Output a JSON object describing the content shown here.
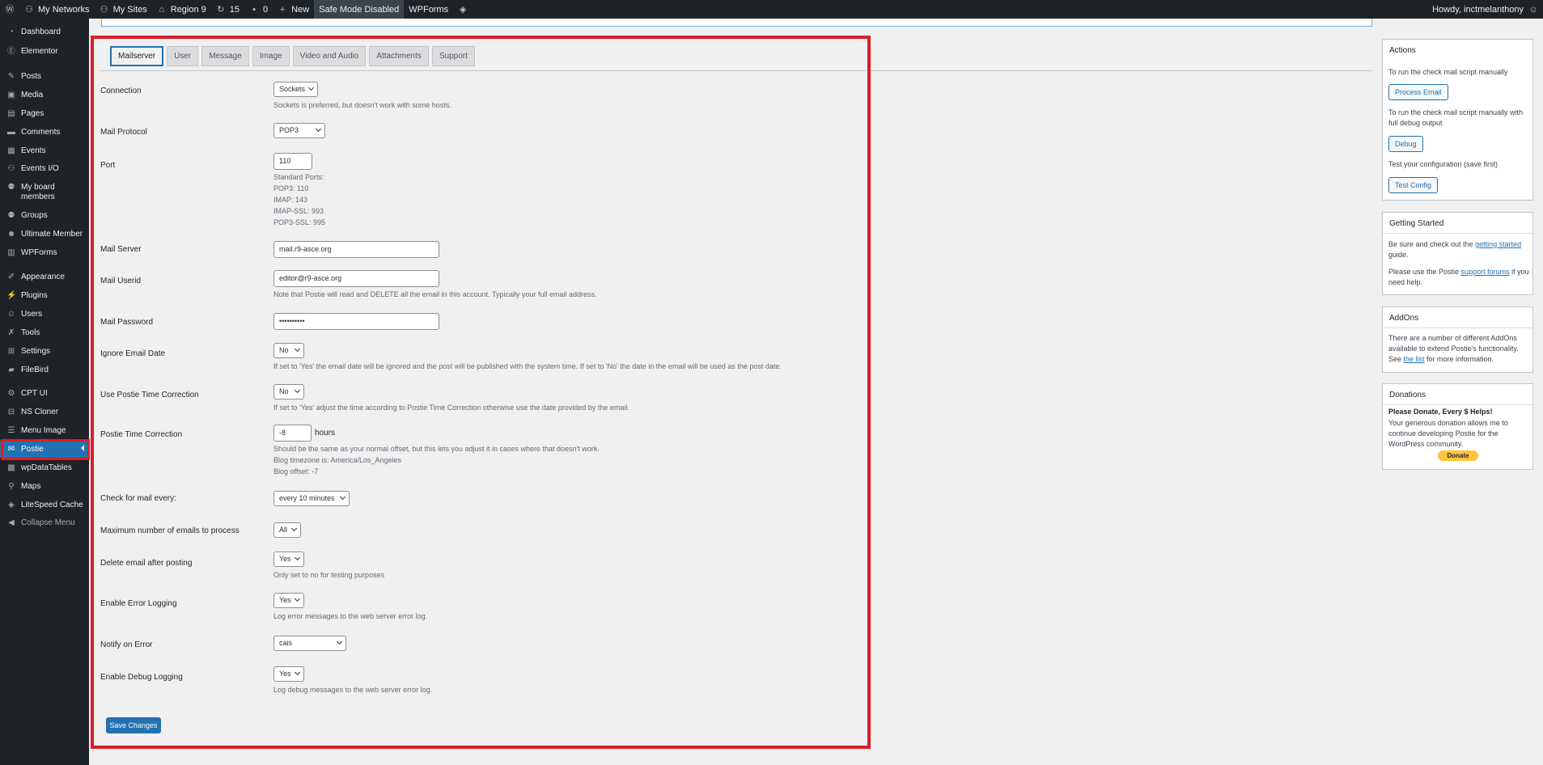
{
  "adminbar": {
    "my_networks": "My Networks",
    "my_sites": "My Sites",
    "region": "Region 9",
    "updates": "15",
    "comments": "0",
    "new": "New",
    "safe_mode": "Safe Mode Disabled",
    "wpforms": "WPForms",
    "howdy": "Howdy, inctmelanthony"
  },
  "sidebar": {
    "items": [
      {
        "label": "Dashboard",
        "icon": "dashboard-icon"
      },
      {
        "label": "Elementor",
        "icon": "elementor-icon"
      },
      {
        "label": "Posts",
        "icon": "pin-icon"
      },
      {
        "label": "Media",
        "icon": "media-icon"
      },
      {
        "label": "Pages",
        "icon": "page-icon"
      },
      {
        "label": "Comments",
        "icon": "comment-icon"
      },
      {
        "label": "Events",
        "icon": "calendar-icon"
      },
      {
        "label": "Events I/O",
        "icon": "network-icon"
      },
      {
        "label": "My board members",
        "icon": "people-icon"
      },
      {
        "label": "Groups",
        "icon": "groups-icon"
      },
      {
        "label": "Ultimate Member",
        "icon": "user-icon"
      },
      {
        "label": "WPForms",
        "icon": "forms-icon"
      },
      {
        "label": "Appearance",
        "icon": "brush-icon"
      },
      {
        "label": "Plugins",
        "icon": "plugin-icon"
      },
      {
        "label": "Users",
        "icon": "users-icon"
      },
      {
        "label": "Tools",
        "icon": "wrench-icon"
      },
      {
        "label": "Settings",
        "icon": "settings-icon"
      },
      {
        "label": "FileBird",
        "icon": "folder-icon"
      },
      {
        "label": "CPT UI",
        "icon": "cpt-icon"
      },
      {
        "label": "NS Cloner",
        "icon": "cloner-icon"
      },
      {
        "label": "Menu Image",
        "icon": "menu-icon"
      },
      {
        "label": "Postie",
        "icon": "mail-icon"
      },
      {
        "label": "wpDataTables",
        "icon": "table-icon"
      },
      {
        "label": "Maps",
        "icon": "map-pin-icon"
      },
      {
        "label": "LiteSpeed Cache",
        "icon": "diamond-icon"
      },
      {
        "label": "Collapse Menu",
        "icon": "collapse-icon"
      }
    ]
  },
  "tabs": [
    "Mailserver",
    "User",
    "Message",
    "Image",
    "Video and Audio",
    "Attachments",
    "Support"
  ],
  "form": {
    "connection": {
      "label": "Connection",
      "value": "Sockets",
      "desc": "Sockets is preferred, but doesn't work with some hosts."
    },
    "protocol": {
      "label": "Mail Protocol",
      "value": "POP3"
    },
    "port": {
      "label": "Port",
      "value": "110",
      "desc": [
        "Standard Ports:",
        "POP3: 110",
        "IMAP: 143",
        "IMAP-SSL: 993",
        "POP3-SSL: 995"
      ]
    },
    "server": {
      "label": "Mail Server",
      "value": "mail.r9-asce.org"
    },
    "userid": {
      "label": "Mail Userid",
      "value": "editor@r9-asce.org",
      "desc": "Note that Postie will read and DELETE all the email in this account. Typically your full email address."
    },
    "password": {
      "label": "Mail Password",
      "value": "••••••••••"
    },
    "ignore_date": {
      "label": "Ignore Email Date",
      "value": "No",
      "desc": "If set to 'Yes' the email date will be ignored and the post will be published with the system time. If set to 'No' the date in the email will be used as the post date."
    },
    "time_correction": {
      "label": "Use Postie Time Correction",
      "value": "No",
      "desc": "If set to 'Yes' adjust the time according to Postie Time Correction otherwise use the date provided by the email."
    },
    "postie_time": {
      "label": "Postie Time Correction",
      "value": "-8",
      "unit": "hours",
      "desc": [
        "Should be the same as your normal offset, but this lets you adjust it in cases where that doesn't work.",
        "Blog timezone is: America/Los_Angeles",
        "Blog offset: -7"
      ]
    },
    "check_every": {
      "label": "Check for mail every:",
      "value": "every 10 minutes"
    },
    "max_emails": {
      "label": "Maximum number of emails to process",
      "value": "All"
    },
    "delete_after": {
      "label": "Delete email after posting",
      "value": "Yes",
      "desc": "Only set to no for testing purposes"
    },
    "error_logging": {
      "label": "Enable Error Logging",
      "value": "Yes",
      "desc": "Log error messages to the web server error log."
    },
    "notify_error": {
      "label": "Notify on Error",
      "value": "cais"
    },
    "debug_logging": {
      "label": "Enable Debug Logging",
      "value": "Yes",
      "desc": "Log debug messages to the web server error log."
    },
    "save": "Save Changes"
  },
  "actions": {
    "title": "Actions",
    "text1": "To run the check mail script manually",
    "process": "Process Email",
    "text2": "To run the check mail script manually with full debug output",
    "debug": "Debug",
    "text3": "Test your configuration (save first)",
    "test": "Test Config"
  },
  "getting_started": {
    "title": "Getting Started",
    "t1": "Be sure and check out the ",
    "link1": "getting started",
    "t2": " guide.",
    "t3": "Please use the Postie ",
    "link2": "support forums",
    "t4": " if you need help."
  },
  "addons": {
    "title": "AddOns",
    "t1": "There are a number of different AddOns available to extend Postie's functionality. See ",
    "link": "the list",
    "t2": " for more information."
  },
  "donations": {
    "title": "Donations",
    "heading": "Please Donate, Every $ Helps!",
    "text": "Your generous donation allows me to continue developing Postie for the WordPress community.",
    "button": "Donate"
  },
  "colors": {
    "accent": "#2271b1",
    "sidebar": "#1d2327",
    "highlight": "#d81e26"
  }
}
